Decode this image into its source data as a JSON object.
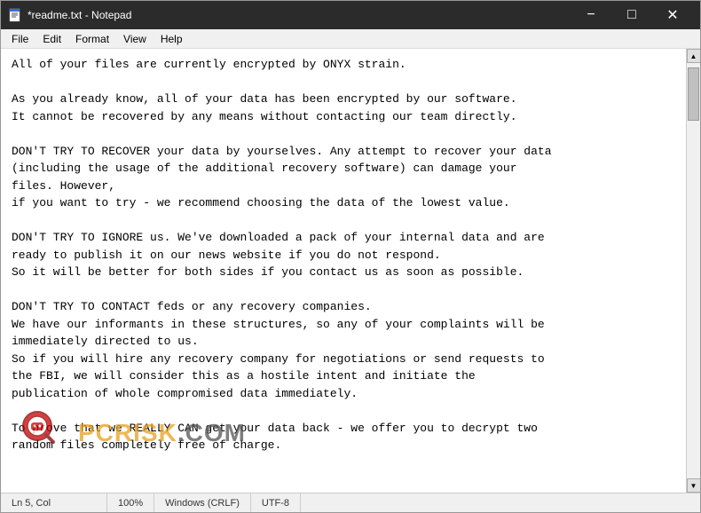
{
  "window": {
    "title": "*readme.txt - Notepad",
    "icon": "notepad"
  },
  "menu": {
    "items": [
      "File",
      "Edit",
      "Format",
      "View",
      "Help"
    ]
  },
  "content": {
    "text": "All of your files are currently encrypted by ONYX strain.\n\nAs you already know, all of your data has been encrypted by our software.\nIt cannot be recovered by any means without contacting our team directly.\n\nDON'T TRY TO RECOVER your data by yourselves. Any attempt to recover your data\n(including the usage of the additional recovery software) can damage your\nfiles. However,\nif you want to try - we recommend choosing the data of the lowest value.\n\nDON'T TRY TO IGNORE us. We've downloaded a pack of your internal data and are\nready to publish it on our news website if you do not respond.\nSo it will be better for both sides if you contact us as soon as possible.\n\nDON'T TRY TO CONTACT feds or any recovery companies.\nWe have our informants in these structures, so any of your complaints will be\nimmediately directed to us.\nSo if you will hire any recovery company for negotiations or send requests to\nthe FBI, we will consider this as a hostile intent and initiate the\npublication of whole compromised data immediately.\n\nTo prove that we REALLY CAN get your data back - we offer you to decrypt two\nrandom files completely free of charge."
  },
  "statusbar": {
    "position": "Ln 5, Col",
    "zoom": "100%",
    "line_ending": "Windows (CRLF)",
    "encoding": "UTF-8"
  },
  "titlebar": {
    "minimize": "−",
    "maximize": "□",
    "close": "✕"
  },
  "watermark": {
    "text": "PCRISK.COM"
  }
}
